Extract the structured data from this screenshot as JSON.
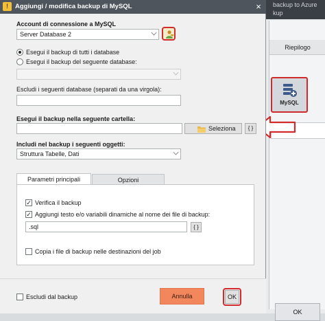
{
  "dialog": {
    "title": "Aggiungi / modifica backup di MySQL",
    "close_glyph": "×",
    "account_label": "Account di connessione a MySQL",
    "account_value": "Server Database 2",
    "radio_all": "Esegui il backup di tutti i database",
    "radio_selected": "Esegui il backup del seguente database:",
    "database_value": "",
    "exclude_label": "Escludi i seguenti database (separati da una virgola):",
    "exclude_value": "",
    "folder_label": "Esegui il backup nella seguente cartella:",
    "folder_value": "",
    "select_button": "Seleziona",
    "vars_button": "{ }",
    "include_label": "Includi nel backup i seguenti oggetti:",
    "include_value": "Struttura Tabelle, Dati",
    "tabs": [
      {
        "label": "Parametri principali",
        "active": true
      },
      {
        "label": "Opzioni",
        "active": false
      }
    ],
    "verify_label": "Verifica il backup",
    "verify_checked": true,
    "append_label": "Aggiungi testo e/o variabili dinamiche al nome dei file di backup:",
    "append_checked": true,
    "append_value": ".sql",
    "append_vars_button": "{ }",
    "copy_label": "Copia i file di backup nelle destinazioni del job",
    "copy_checked": false,
    "exclude_backup_label": "Escludi dal backup",
    "exclude_backup_checked": false,
    "cancel_button": "Annulla",
    "ok_button": "OK"
  },
  "background": {
    "fragment_1": "backup to Azure",
    "fragment_2": "kup",
    "tab_label": "Riepilogo",
    "mysql_button": "MySQL",
    "ok_button": "OK"
  },
  "colors": {
    "highlight": "#d12b2b",
    "cancel_button": "#f2865c",
    "titlebar": "#4e555c"
  },
  "icons": [
    "close-icon",
    "key-icon",
    "user-icon",
    "folder-icon",
    "database-icon",
    "arrow-left-icon",
    "chevron-down-icon"
  ]
}
